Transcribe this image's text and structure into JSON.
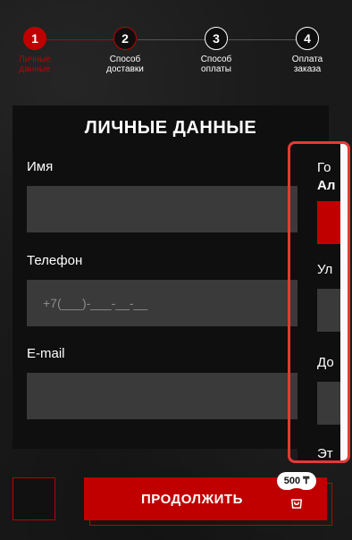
{
  "stepper": {
    "steps": [
      {
        "number": "1",
        "label_line1": "Личные",
        "label_line2": "данные"
      },
      {
        "number": "2",
        "label_line1": "Способ",
        "label_line2": "доставки"
      },
      {
        "number": "3",
        "label_line1": "Способ",
        "label_line2": "оплаты"
      },
      {
        "number": "4",
        "label_line1": "Оплата",
        "label_line2": "заказа"
      }
    ],
    "active_step": 1
  },
  "form": {
    "title": "ЛИЧНЫЕ ДАННЫЕ",
    "name_label": "Имя",
    "name_value": "",
    "phone_label": "Телефон",
    "phone_placeholder": "+7(___)-___-__-__",
    "email_label": "E-mail",
    "email_value": ""
  },
  "side_panel": {
    "city_label_partial": "Го",
    "city_value_partial": "Ал",
    "street_label_partial": "Ул",
    "house_label_partial": "До",
    "floor_label_partial": "Эт"
  },
  "bottom": {
    "continue_label": "ПРОДОЛЖИТЬ",
    "cart_price": "500 ₸"
  },
  "colors": {
    "accent": "#c00000",
    "highlight_frame": "#e53935",
    "input_bg": "#3a3a3a"
  }
}
